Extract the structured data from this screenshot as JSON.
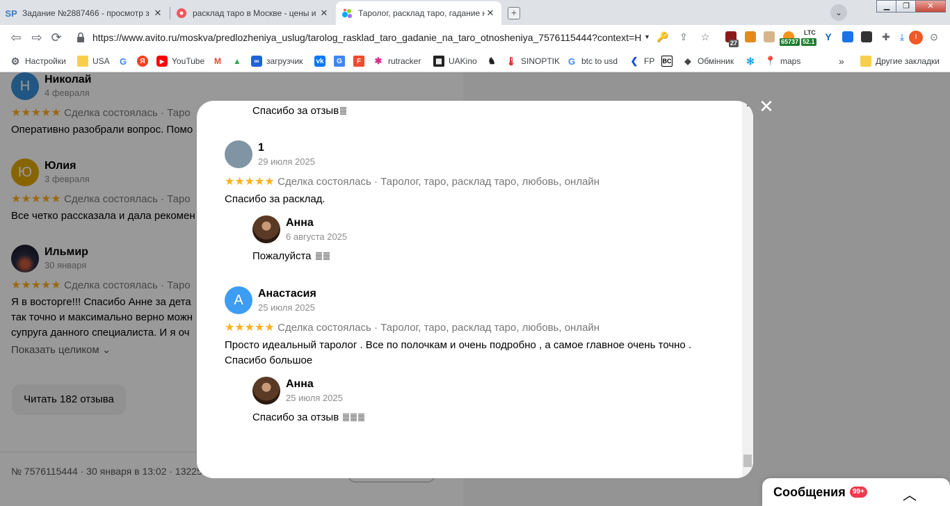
{
  "browser": {
    "tabs": [
      {
        "title": "Задание №2887466 - просмотр з",
        "favicon": "SP"
      },
      {
        "title": "расклад таро в Москве - цены и",
        "favicon": ""
      },
      {
        "title": "Таролог, расклад таро, гадание н",
        "favicon": ""
      }
    ],
    "address": "https://www.avito.ru/moskva/predlozheniya_uslug/tarolog_rasklad_taro_gadanie_na_taro_otnosheniya_7576115444?context=H...",
    "ext_badges": {
      "e1": "27",
      "ltc_label": "LTC",
      "btc_price": "65737",
      "ltc_price": "52.1"
    },
    "profile_initial": "I",
    "bookmarks": [
      {
        "label": "Настройки"
      },
      {
        "label": "USA"
      },
      {
        "label": "YouTube"
      },
      {
        "label": "загрузчик"
      },
      {
        "label": "rutracker"
      },
      {
        "label": "UAKino"
      },
      {
        "label": "SINOPTIK"
      },
      {
        "label": "btc to usd"
      },
      {
        "label": "FP"
      },
      {
        "label": "Обмінник"
      },
      {
        "label": "maps"
      }
    ],
    "bookmarks_more": "»",
    "other_bookmarks": "Другие закладки"
  },
  "background_reviews": [
    {
      "initial": "Н",
      "name": "Николай",
      "date": "4 февраля",
      "deal": "Сделка состоялась · Таро",
      "text": "Оперативно разобрали вопрос. Помо",
      "color": "#3a8fd9"
    },
    {
      "initial": "Ю",
      "name": "Юлия",
      "date": "3 февраля",
      "deal": "Сделка состоялась · Таро",
      "text": "Все четко рассказала и дала рекомен",
      "color": "#e0a800"
    },
    {
      "initial": "",
      "name": "Ильмир",
      "date": "30 января",
      "deal": "Сделка состоялась · Таро",
      "text_lines": [
        "Я в восторге!!! Спасибо Анне за дета",
        "так точно и максимально верно можн",
        "супруга данного специалиста. И я оч"
      ],
      "color": "#2b2b44"
    }
  ],
  "show_full": "Показать целиком",
  "read_reviews_button": "Читать 182 отзыва",
  "listing_footer": "№ 7576115444 · 30 января в 13:02 · 13225 п",
  "modal": {
    "top_reply": "Спасибо за отзыв",
    "reviews": [
      {
        "initial": "",
        "avatar_color": "#7f95a3",
        "name": "1",
        "date": "29 июля 2025",
        "stars": "★★★★★",
        "deal": "Сделка состоялась · Таролог, таро, расклад таро, любовь, онлайн",
        "text": "Спасибо за расклад.",
        "reply": {
          "name": "Анна",
          "date": "6 августа 2025",
          "text": "Пожалуйста"
        }
      },
      {
        "initial": "А",
        "avatar_color": "#3d9df2",
        "name": "Анастасия",
        "date": "25 июля 2025",
        "stars": "★★★★★",
        "deal": "Сделка состоялась · Таролог, таро, расклад таро, любовь, онлайн",
        "text_lines": [
          "Просто идеальный таролог . Все по полочкам и очень подробно , а самое главное очень точно .",
          "Спасибо большое"
        ],
        "reply": {
          "name": "Анна",
          "date": "25 июля 2025",
          "text": "Спасибо за отзыв"
        }
      }
    ]
  },
  "messages": {
    "title": "Сообщения",
    "badge": "99+"
  },
  "colors": {
    "star": "#ffb021",
    "overlay": "rgba(0,0,0,0.4)",
    "badge": "#f0384f"
  }
}
